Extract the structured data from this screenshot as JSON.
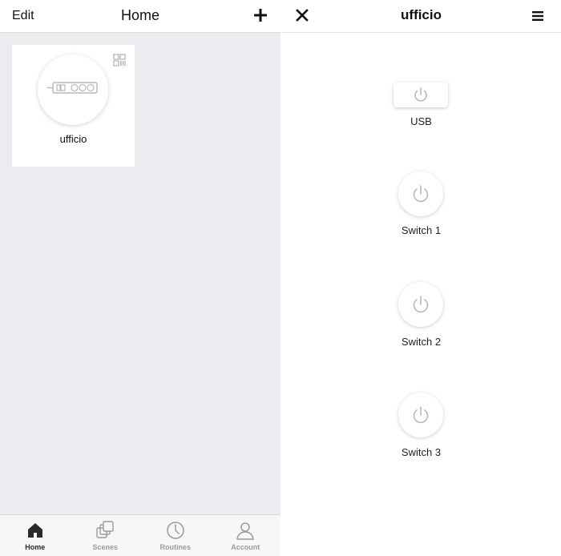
{
  "left": {
    "header": {
      "edit_label": "Edit",
      "title": "Home"
    },
    "devices": [
      {
        "name": "ufficio"
      }
    ],
    "tabs": [
      {
        "label": "Home",
        "icon": "home-icon",
        "active": true
      },
      {
        "label": "Scenes",
        "icon": "scenes-icon",
        "active": false
      },
      {
        "label": "Routines",
        "icon": "clock-icon",
        "active": false
      },
      {
        "label": "Account",
        "icon": "person-icon",
        "active": false
      }
    ]
  },
  "right": {
    "header": {
      "title": "ufficio"
    },
    "controls": [
      {
        "label": "USB",
        "icon": "power-icon"
      },
      {
        "label": "Switch 1",
        "icon": "power-icon"
      },
      {
        "label": "Switch 2",
        "icon": "power-icon"
      },
      {
        "label": "Switch 3",
        "icon": "power-icon"
      }
    ]
  },
  "colors": {
    "background": "#ecebf0",
    "icon_gray": "#b8b8bc",
    "active_tab": "#2a2a2a",
    "inactive_tab": "#9a9a9e"
  }
}
